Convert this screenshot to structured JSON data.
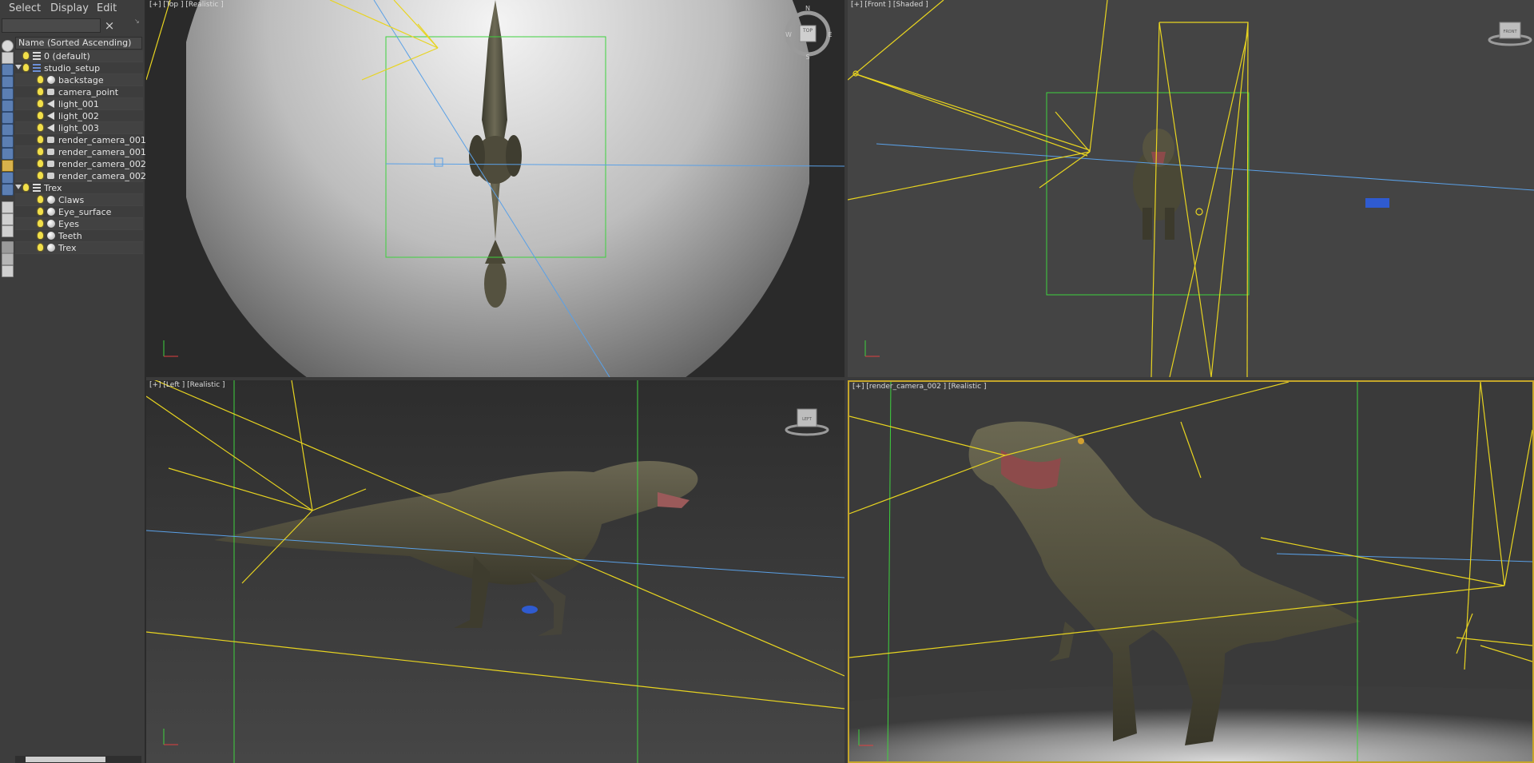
{
  "menu": {
    "select": "Select",
    "display": "Display",
    "edit": "Edit"
  },
  "search": {
    "value": "",
    "clear_icon": "×",
    "pin_icon": "↘"
  },
  "list_header": "Name (Sorted Ascending)",
  "tree": [
    {
      "label": "0 (default)",
      "icon": "layer-icon",
      "level": 1,
      "expand": false
    },
    {
      "label": "studio_setup",
      "icon": "layer-blue-icon",
      "level": 1,
      "expand": true
    },
    {
      "label": "backstage",
      "icon": "sphere-icon",
      "level": 2,
      "expand": false
    },
    {
      "label": "camera_point",
      "icon": "camera-icon",
      "level": 2,
      "expand": false
    },
    {
      "label": "light_001",
      "icon": "light-icon",
      "level": 2,
      "expand": false
    },
    {
      "label": "light_002",
      "icon": "light-icon",
      "level": 2,
      "expand": false
    },
    {
      "label": "light_003",
      "icon": "light-icon",
      "level": 2,
      "expand": false
    },
    {
      "label": "render_camera_001",
      "icon": "camera-icon",
      "level": 2,
      "expand": false
    },
    {
      "label": "render_camera_001",
      "icon": "camera-icon",
      "level": 2,
      "expand": false
    },
    {
      "label": "render_camera_002",
      "icon": "camera-icon",
      "level": 2,
      "expand": false
    },
    {
      "label": "render_camera_002",
      "icon": "camera-icon",
      "level": 2,
      "expand": false
    },
    {
      "label": "Trex",
      "icon": "layer-icon",
      "level": 1,
      "expand": true
    },
    {
      "label": "Claws",
      "icon": "sphere-icon",
      "level": 2,
      "expand": false
    },
    {
      "label": "Eye_surface",
      "icon": "sphere-icon",
      "level": 2,
      "expand": false
    },
    {
      "label": "Eyes",
      "icon": "sphere-icon",
      "level": 2,
      "expand": false
    },
    {
      "label": "Teeth",
      "icon": "sphere-icon",
      "level": 2,
      "expand": false
    },
    {
      "label": "Trex",
      "icon": "sphere-icon",
      "level": 2,
      "expand": false
    }
  ],
  "viewports": {
    "top": {
      "label": "[+] [Top ] [Realistic ]",
      "compass": {
        "n": "N",
        "s": "S",
        "e": "E",
        "w": "W",
        "cube": "TOP"
      }
    },
    "front": {
      "label": "[+] [Front ] [Shaded ]",
      "cube": "FRONT"
    },
    "left": {
      "label": "[+] [Left ] [Realistic ]",
      "cube": "LEFT"
    },
    "camera": {
      "label": "[+] [render_camera_002 ] [Realistic ]"
    }
  },
  "colors": {
    "light_gizmo": "#e8d420",
    "bounds": "#3ed23e",
    "camera_ray": "#5aa0e6",
    "active_border": "#c4a52a"
  }
}
